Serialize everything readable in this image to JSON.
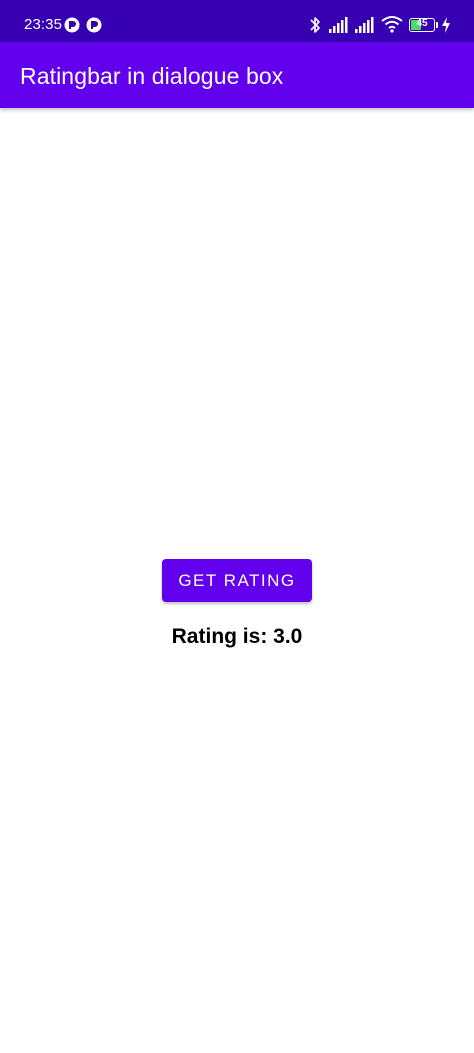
{
  "status_bar": {
    "time": "23:35",
    "battery_level": "45",
    "background_color": "#3700B3",
    "icons": [
      "notification-app-icon",
      "notification-app-icon",
      "bluetooth-icon",
      "signal-icon",
      "signal-icon",
      "wifi-icon",
      "battery-icon",
      "charging-icon"
    ]
  },
  "app_bar": {
    "title": "Ratingbar in dialogue box",
    "background_color": "#6200EE"
  },
  "main": {
    "button_label": "GET RATING",
    "rating_text": "Rating is: 3.0"
  }
}
